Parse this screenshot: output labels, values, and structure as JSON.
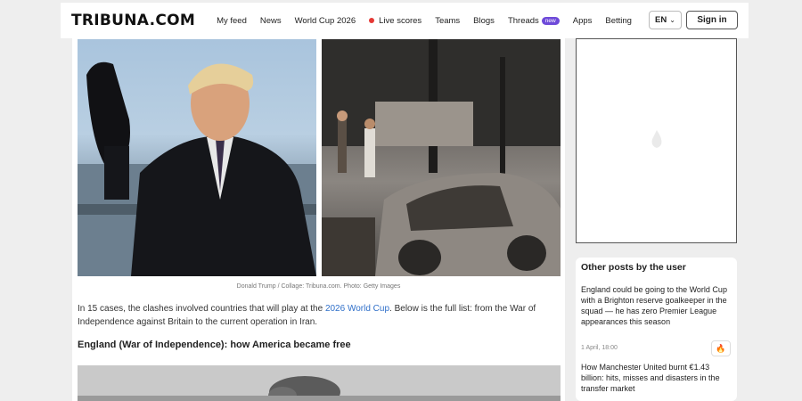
{
  "header": {
    "logo": "TRIBUNA.COM",
    "nav": [
      {
        "label": "My feed"
      },
      {
        "label": "News"
      },
      {
        "label": "World Cup 2026"
      },
      {
        "label": "Live scores"
      },
      {
        "label": "Teams"
      },
      {
        "label": "Blogs"
      },
      {
        "label": "Threads",
        "badge": "new"
      },
      {
        "label": "Apps"
      },
      {
        "label": "Betting"
      }
    ],
    "lang": "EN",
    "signin": "Sign in"
  },
  "article": {
    "caption": "Donald Trump / Collage: Tribuna.com. Photo: Getty Images",
    "para_before": "In 15 cases, the clashes involved countries that will play at the ",
    "para_link": "2026 World Cup",
    "para_after": ". Below is the full list: from the War of Independence against Britain to the current operation in Iran.",
    "subhead": "England (War of Independence): how America became free"
  },
  "sidebar": {
    "title": "Other posts by the user",
    "posts": [
      {
        "title": "England could be going to the World Cup with a Brighton reserve goalkeeper in the squad — he has zero Premier League appearances this season",
        "time": "1 April, 18:00"
      },
      {
        "title": "How Manchester United burnt €1.43 billion: hits, misses and disasters in the transfer market",
        "time": ""
      }
    ]
  },
  "colors": {
    "accent": "#6e4ad9",
    "live": "#e53935",
    "link": "#2f6fc9"
  },
  "icons": [
    "chevron-down-icon",
    "live-dot-icon",
    "fire-icon"
  ]
}
